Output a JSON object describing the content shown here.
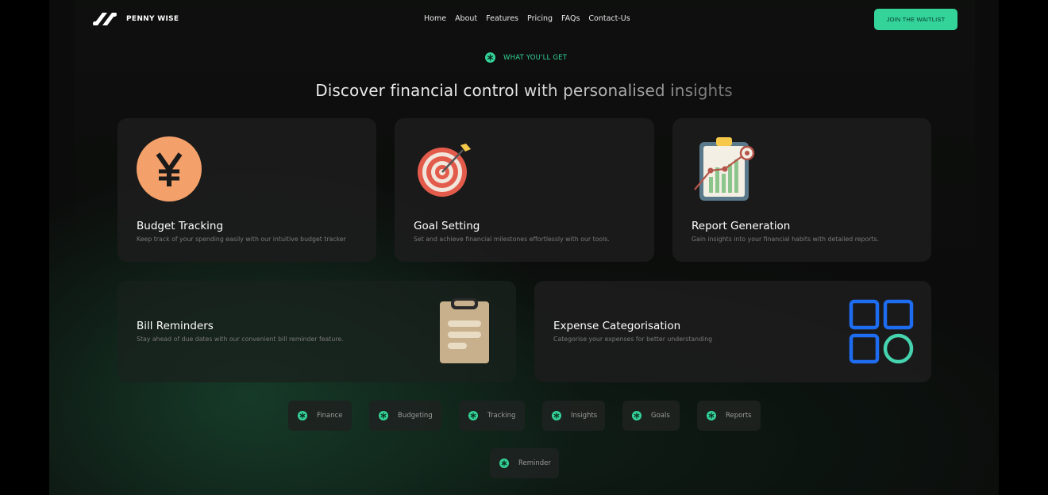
{
  "nav": {
    "brand": "PENNY WISE",
    "links": [
      "Home",
      "About",
      "Features",
      "Pricing",
      "FAQs",
      "Contact-Us"
    ],
    "cta_label": "JOIN THE WAITLIST"
  },
  "section": {
    "eyebrow": "WHAT YOU'LL GET",
    "heading": "Discover financial control with personalised insights"
  },
  "features": [
    {
      "title": "Budget Tracking",
      "description": "Keep track of your spending easily with our intuitive budget tracker",
      "icon": "yen-coin-icon"
    },
    {
      "title": "Goal Setting",
      "description": "Set and achieve financial milestones effortlessly with our tools.",
      "icon": "target-icon"
    },
    {
      "title": "Report Generation",
      "description": "Gain insights into your financial habits with detailed reports.",
      "icon": "report-chart-icon"
    },
    {
      "title": "Bill Reminders",
      "description": "Stay ahead of due dates with our convenient bill reminder feature.",
      "icon": "clipboard-icon"
    },
    {
      "title": "Expense Categorisation",
      "description": "Categorise your expenses for better understanding",
      "icon": "categories-grid-icon"
    }
  ],
  "tags": [
    "Finance",
    "Budgeting",
    "Tracking",
    "Insights",
    "Goals",
    "Reports",
    "Reminder"
  ],
  "colors": {
    "accent": "#34d399",
    "background": "#0b0c0b",
    "card": "#1c1c1c",
    "coin": "#f4a06a",
    "categories_blue": "#1e6cf0"
  }
}
